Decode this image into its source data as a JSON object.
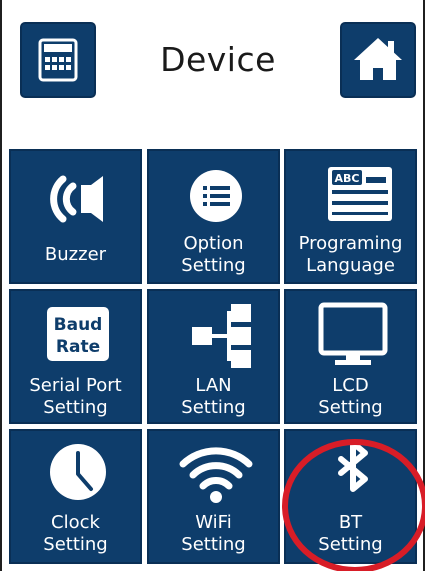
{
  "header": {
    "title": "Device",
    "left_icon": "keypad-icon",
    "right_icon": "home-icon"
  },
  "tiles": [
    {
      "name": "buzzer",
      "icon": "speaker-sound-icon",
      "lines": [
        "Buzzer"
      ]
    },
    {
      "name": "option-setting",
      "icon": "list-icon",
      "lines": [
        "Option",
        "Setting"
      ]
    },
    {
      "name": "programing-language",
      "icon": "abc-document-icon",
      "icon_text": "ABC",
      "lines": [
        "Programing",
        "Language"
      ]
    },
    {
      "name": "serial-port-setting",
      "icon": "baud-rate-icon",
      "icon_text": [
        "Baud",
        "Rate"
      ],
      "lines": [
        "Serial Port",
        "Setting"
      ]
    },
    {
      "name": "lan-setting",
      "icon": "network-tree-icon",
      "lines": [
        "LAN",
        "Setting"
      ]
    },
    {
      "name": "lcd-setting",
      "icon": "monitor-icon",
      "lines": [
        "LCD",
        "Setting"
      ]
    },
    {
      "name": "clock-setting",
      "icon": "clock-icon",
      "lines": [
        "Clock",
        "Setting"
      ]
    },
    {
      "name": "wifi-setting",
      "icon": "wifi-icon",
      "lines": [
        "WiFi",
        "Setting"
      ]
    },
    {
      "name": "bt-setting",
      "icon": "bluetooth-icon",
      "lines": [
        "BT",
        "Setting"
      ]
    }
  ],
  "colors": {
    "tile": "#0e3d6b",
    "tile_border": "#0a2f55",
    "highlight_circle": "#d81d27"
  }
}
